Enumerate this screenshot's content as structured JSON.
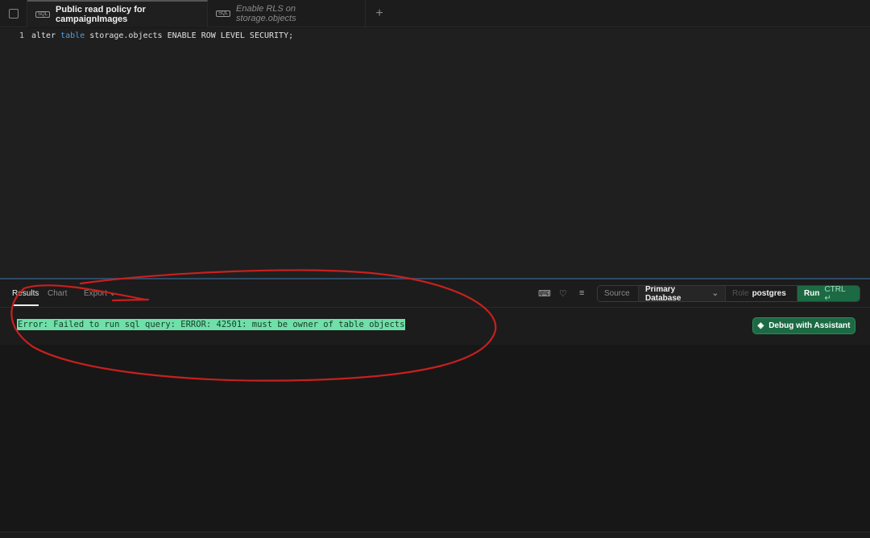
{
  "tabs": [
    {
      "label": "Public read policy for campaignImages",
      "icon": "sql-icon",
      "active": true
    },
    {
      "label": "Enable RLS on storage.objects",
      "icon": "sql-icon",
      "active": false
    }
  ],
  "editor": {
    "line_number": "1",
    "code_pre": "alter ",
    "code_kw": "table",
    "code_post": " storage.objects ENABLE ROW LEVEL SECURITY;"
  },
  "results": {
    "tabs": [
      "Results",
      "Chart",
      "Export"
    ],
    "source_label": "Source",
    "database": "Primary Database",
    "role_label": "Role",
    "role": "postgres",
    "run_label": "Run",
    "run_shortcut": "CTRL ↵",
    "error": "Error: Failed to run sql query: ERROR: 42501: must be owner of table objects",
    "debug_label": "Debug with Assistant"
  },
  "colors": {
    "accent": "#1c6a43",
    "error_highlight": "#6ee0a8",
    "annotation": "#c8201e"
  }
}
